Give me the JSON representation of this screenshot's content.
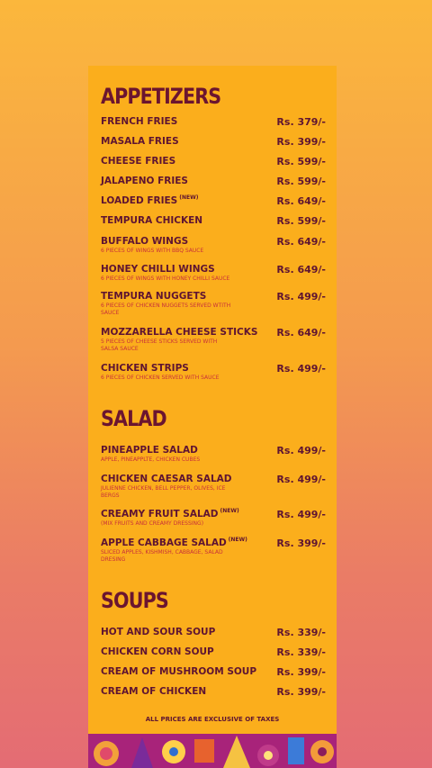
{
  "colors": {
    "accent": "#6b1530",
    "desc": "#c8303a",
    "card": "#fbae1c"
  },
  "sections": [
    {
      "title": "APPETIZERS",
      "items": [
        {
          "name": "FRENCH FRIES",
          "price": "Rs. 379/-"
        },
        {
          "name": "MASALA FRIES",
          "price": "Rs. 399/-"
        },
        {
          "name": "CHEESE FRIES",
          "price": "Rs. 599/-"
        },
        {
          "name": "JALAPENO FRIES",
          "price": "Rs. 599/-"
        },
        {
          "name": "LOADED FRIES",
          "tag": "(NEW)",
          "price": "Rs. 649/-"
        },
        {
          "name": "TEMPURA CHICKEN",
          "price": "Rs. 599/-"
        },
        {
          "name": "BUFFALO WINGS",
          "desc": "6 PIECES OF WINGS WITH BBQ SAUCE",
          "price": "Rs. 649/-"
        },
        {
          "name": "HONEY CHILLI WINGS",
          "desc": "6 PIECES OF WINGS WITH HONEY CHILLI SAUCE",
          "price": "Rs. 649/-"
        },
        {
          "name": "TEMPURA NUGGETS",
          "desc": "6 PIECES OF CHICKEN NUGGETS SERVED WTITH SAUCE",
          "price": "Rs. 499/-"
        },
        {
          "name": "MOZZARELLA CHEESE STICKS",
          "desc": "5 PIECES OF CHEESE STICKS SERVED WITH SALSA SAUCE",
          "price": "Rs. 649/-"
        },
        {
          "name": "CHICKEN STRIPS",
          "desc": "6 PIECES OF CHICKEN SERVED WITH SAUCE",
          "price": "Rs. 499/-"
        }
      ]
    },
    {
      "title": "SALAD",
      "items": [
        {
          "name": "PINEAPPLE SALAD",
          "desc": "APPLE, PINEAPPLTE, CHICKEN CUBES",
          "price": "Rs. 499/-"
        },
        {
          "name": "CHICKEN CAESAR SALAD",
          "desc": "JULIENNE CHICKEN, BELL PEPPER, OLIVES, ICE BERGS",
          "price": "Rs. 499/-"
        },
        {
          "name": "CREAMY FRUIT SALAD",
          "tag": "(NEW)",
          "desc": "(MIX FRUITS AND CREAMY DRESSING)",
          "price": "Rs. 499/-"
        },
        {
          "name": "APPLE CABBAGE SALAD",
          "tag": "(NEW)",
          "desc": "SLICED APPLES, KISHMISH, CABBAGE, SALAD DRESING",
          "price": "Rs. 399/-"
        }
      ]
    },
    {
      "title": "SOUPS",
      "items": [
        {
          "name": "HOT AND SOUR SOUP",
          "price": "Rs. 339/-"
        },
        {
          "name": "CHICKEN CORN SOUP",
          "price": "Rs. 339/-"
        },
        {
          "name": "CREAM OF MUSHROOM SOUP",
          "price": "Rs. 399/-"
        },
        {
          "name": "CREAM OF CHICKEN",
          "price": "Rs. 399/-"
        }
      ]
    }
  ],
  "footer": "ALL PRICES ARE EXCLUSIVE OF TAXES"
}
